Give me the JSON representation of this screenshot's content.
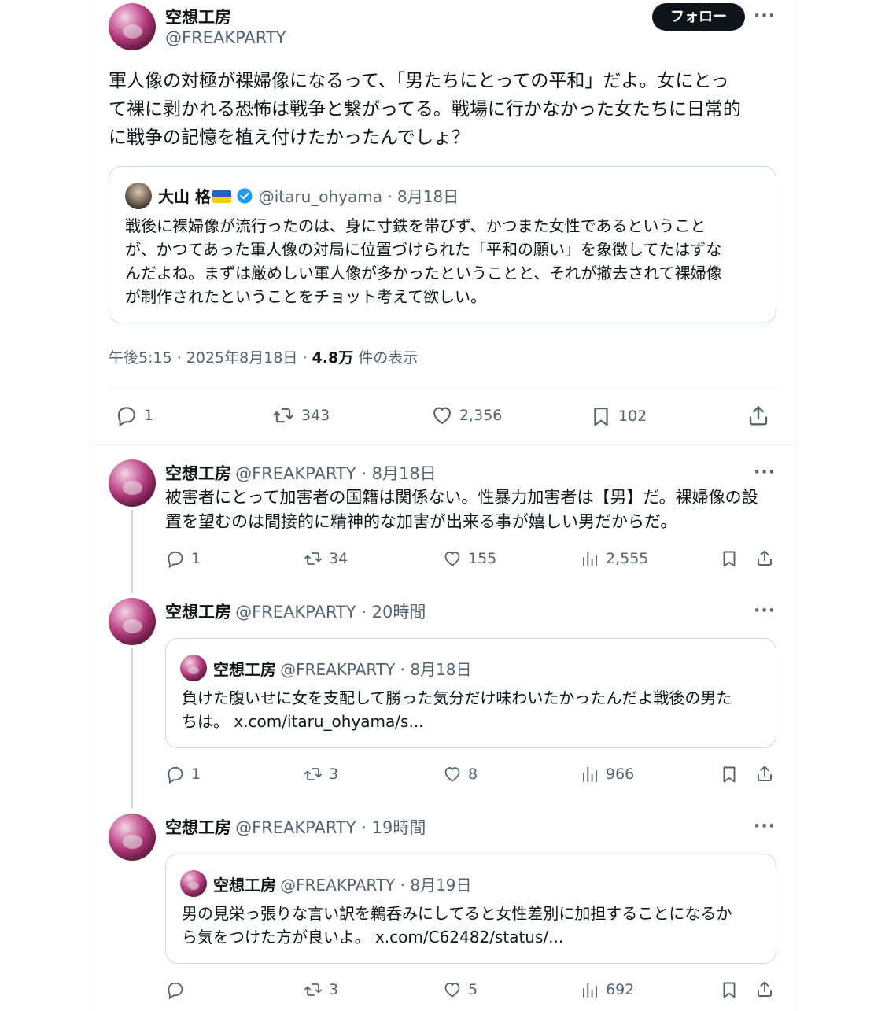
{
  "main_post": {
    "author_name": "空想工房",
    "author_handle": "@FREAKPARTY",
    "follow_label": "フォロー",
    "more_label": "···",
    "text_lines": [
      "軍人像の対極が裸婦像になるって、「男たちにとっての平和」だよ。女にとっ",
      "て裸に剥かれる恐怖は戦争と繋がってる。戦場に行かなかった女たちに日常的",
      "に戦争の記憶を植え付けたかったんでしょ？"
    ],
    "quote": {
      "author_name": "大山 格",
      "author_handle": "@itaru_ohyama",
      "date": "· 8月18日",
      "text_lines": [
        "戦後に裸婦像が流行ったのは、身に寸鉄を帯びず、かつまた女性であるということ",
        "が、かつてあった軍人像の対局に位置づけられた「平和の願い」を象徴してたはずな",
        "んだよね。まずは厳めしい軍人像が多かったということと、それが撤去されて裸婦像",
        "が制作されたということをチョット考えて欲しい。"
      ]
    },
    "meta": {
      "time_date": "午後5:15 · 2025年8月18日 · ",
      "views_count": "4.8万",
      "views_label": " 件の表示"
    },
    "stats": {
      "replies": "1",
      "reposts": "343",
      "likes": "2,356",
      "bookmarks": "102"
    }
  },
  "replies": [
    {
      "author_name": "空想工房",
      "handle_time": "@FREAKPARTY · 8月18日",
      "text_lines": [
        "被害者にとって加害者の国籍は関係ない。性暴力加害者は【男】だ。裸婦像の設",
        "置を望むのは間接的に精神的な加害が出来る事が嬉しい男だからだ。"
      ],
      "stats": {
        "replies": "1",
        "reposts": "34",
        "likes": "155",
        "views": "2,555"
      }
    },
    {
      "author_name": "空想工房",
      "handle_time": "@FREAKPARTY · 20時間",
      "quote": {
        "author_name": "空想工房",
        "handle_time": "@FREAKPARTY · 8月18日",
        "text_lines": [
          "負けた腹いせに女を支配して勝った気分だけ味わいたかったんだよ戦後の男た",
          "ちは。 x.com/itaru_ohyama/s..."
        ]
      },
      "stats": {
        "replies": "1",
        "reposts": "3",
        "likes": "8",
        "views": "966"
      }
    },
    {
      "author_name": "空想工房",
      "handle_time": "@FREAKPARTY · 19時間",
      "quote": {
        "author_name": "空想工房",
        "handle_time": "@FREAKPARTY · 8月19日",
        "text_lines": [
          "男の見栄っ張りな言い訳を鵜呑みにしてると女性差別に加担することになるか",
          "ら気をつけた方が良いよ。 x.com/C62482/status/..."
        ]
      },
      "stats": {
        "replies": "",
        "reposts": "3",
        "likes": "5",
        "views": "692"
      }
    }
  ],
  "colors": {
    "text": "#0f1419",
    "secondary": "#536471",
    "border": "#cfd9de",
    "verified": "#1d9bf0",
    "follow_bg": "#0f1419"
  },
  "icons": [
    "reply-icon",
    "repost-icon",
    "like-icon",
    "bookmark-icon",
    "share-icon",
    "views-icon",
    "verified-badge-icon",
    "ukraine-flag-icon",
    "more-icon"
  ]
}
